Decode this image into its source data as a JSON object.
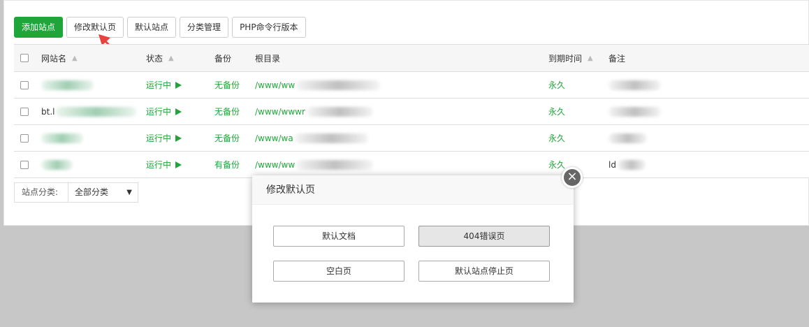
{
  "toolbar": {
    "add_site": "添加站点",
    "modify_default_page": "修改默认页",
    "default_site": "默认站点",
    "category_manage": "分类管理",
    "php_cli_version": "PHP命令行版本"
  },
  "table": {
    "headers": {
      "name": "网站名",
      "status": "状态",
      "backup": "备份",
      "root": "根目录",
      "expire": "到期时间",
      "note": "备注"
    },
    "rows": [
      {
        "name": "",
        "status": "运行中",
        "backup": "无备份",
        "root": "/www/ww",
        "expire": "永久",
        "note": ""
      },
      {
        "name": "bt.l",
        "status": "运行中",
        "backup": "无备份",
        "root": "/www/wwwr",
        "expire": "永久",
        "note": ""
      },
      {
        "name": "",
        "status": "运行中",
        "backup": "无备份",
        "root": "/www/wa",
        "expire": "永久",
        "note": ""
      },
      {
        "name": "",
        "status": "运行中",
        "backup": "有备份",
        "root": "/www/ww",
        "expire": "永久",
        "note": "ld"
      }
    ]
  },
  "category": {
    "label": "站点分类:",
    "selected": "全部分类"
  },
  "modal": {
    "title": "修改默认页",
    "buttons": {
      "default_doc": "默认文档",
      "error_404": "404错误页",
      "blank": "空白页",
      "site_stopped": "默认站点停止页"
    },
    "selected": "404错误页"
  },
  "colors": {
    "accent": "#20a53a",
    "arrow": "#e8423f"
  }
}
